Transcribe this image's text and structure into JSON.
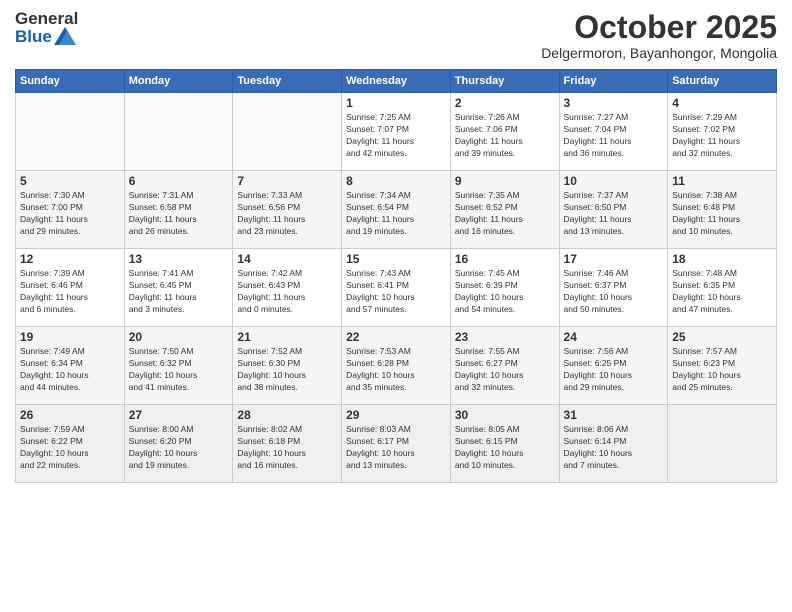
{
  "header": {
    "logo_general": "General",
    "logo_blue": "Blue",
    "month_title": "October 2025",
    "location": "Delgermoron, Bayanhongor, Mongolia"
  },
  "weekdays": [
    "Sunday",
    "Monday",
    "Tuesday",
    "Wednesday",
    "Thursday",
    "Friday",
    "Saturday"
  ],
  "weeks": [
    [
      {
        "day": "",
        "info": ""
      },
      {
        "day": "",
        "info": ""
      },
      {
        "day": "",
        "info": ""
      },
      {
        "day": "1",
        "info": "Sunrise: 7:25 AM\nSunset: 7:07 PM\nDaylight: 11 hours\nand 42 minutes."
      },
      {
        "day": "2",
        "info": "Sunrise: 7:26 AM\nSunset: 7:06 PM\nDaylight: 11 hours\nand 39 minutes."
      },
      {
        "day": "3",
        "info": "Sunrise: 7:27 AM\nSunset: 7:04 PM\nDaylight: 11 hours\nand 36 minutes."
      },
      {
        "day": "4",
        "info": "Sunrise: 7:29 AM\nSunset: 7:02 PM\nDaylight: 11 hours\nand 32 minutes."
      }
    ],
    [
      {
        "day": "5",
        "info": "Sunrise: 7:30 AM\nSunset: 7:00 PM\nDaylight: 11 hours\nand 29 minutes."
      },
      {
        "day": "6",
        "info": "Sunrise: 7:31 AM\nSunset: 6:58 PM\nDaylight: 11 hours\nand 26 minutes."
      },
      {
        "day": "7",
        "info": "Sunrise: 7:33 AM\nSunset: 6:56 PM\nDaylight: 11 hours\nand 23 minutes."
      },
      {
        "day": "8",
        "info": "Sunrise: 7:34 AM\nSunset: 6:54 PM\nDaylight: 11 hours\nand 19 minutes."
      },
      {
        "day": "9",
        "info": "Sunrise: 7:35 AM\nSunset: 6:52 PM\nDaylight: 11 hours\nand 16 minutes."
      },
      {
        "day": "10",
        "info": "Sunrise: 7:37 AM\nSunset: 6:50 PM\nDaylight: 11 hours\nand 13 minutes."
      },
      {
        "day": "11",
        "info": "Sunrise: 7:38 AM\nSunset: 6:48 PM\nDaylight: 11 hours\nand 10 minutes."
      }
    ],
    [
      {
        "day": "12",
        "info": "Sunrise: 7:39 AM\nSunset: 6:46 PM\nDaylight: 11 hours\nand 6 minutes."
      },
      {
        "day": "13",
        "info": "Sunrise: 7:41 AM\nSunset: 6:45 PM\nDaylight: 11 hours\nand 3 minutes."
      },
      {
        "day": "14",
        "info": "Sunrise: 7:42 AM\nSunset: 6:43 PM\nDaylight: 11 hours\nand 0 minutes."
      },
      {
        "day": "15",
        "info": "Sunrise: 7:43 AM\nSunset: 6:41 PM\nDaylight: 10 hours\nand 57 minutes."
      },
      {
        "day": "16",
        "info": "Sunrise: 7:45 AM\nSunset: 6:39 PM\nDaylight: 10 hours\nand 54 minutes."
      },
      {
        "day": "17",
        "info": "Sunrise: 7:46 AM\nSunset: 6:37 PM\nDaylight: 10 hours\nand 50 minutes."
      },
      {
        "day": "18",
        "info": "Sunrise: 7:48 AM\nSunset: 6:35 PM\nDaylight: 10 hours\nand 47 minutes."
      }
    ],
    [
      {
        "day": "19",
        "info": "Sunrise: 7:49 AM\nSunset: 6:34 PM\nDaylight: 10 hours\nand 44 minutes."
      },
      {
        "day": "20",
        "info": "Sunrise: 7:50 AM\nSunset: 6:32 PM\nDaylight: 10 hours\nand 41 minutes."
      },
      {
        "day": "21",
        "info": "Sunrise: 7:52 AM\nSunset: 6:30 PM\nDaylight: 10 hours\nand 38 minutes."
      },
      {
        "day": "22",
        "info": "Sunrise: 7:53 AM\nSunset: 6:28 PM\nDaylight: 10 hours\nand 35 minutes."
      },
      {
        "day": "23",
        "info": "Sunrise: 7:55 AM\nSunset: 6:27 PM\nDaylight: 10 hours\nand 32 minutes."
      },
      {
        "day": "24",
        "info": "Sunrise: 7:56 AM\nSunset: 6:25 PM\nDaylight: 10 hours\nand 29 minutes."
      },
      {
        "day": "25",
        "info": "Sunrise: 7:57 AM\nSunset: 6:23 PM\nDaylight: 10 hours\nand 25 minutes."
      }
    ],
    [
      {
        "day": "26",
        "info": "Sunrise: 7:59 AM\nSunset: 6:22 PM\nDaylight: 10 hours\nand 22 minutes."
      },
      {
        "day": "27",
        "info": "Sunrise: 8:00 AM\nSunset: 6:20 PM\nDaylight: 10 hours\nand 19 minutes."
      },
      {
        "day": "28",
        "info": "Sunrise: 8:02 AM\nSunset: 6:18 PM\nDaylight: 10 hours\nand 16 minutes."
      },
      {
        "day": "29",
        "info": "Sunrise: 8:03 AM\nSunset: 6:17 PM\nDaylight: 10 hours\nand 13 minutes."
      },
      {
        "day": "30",
        "info": "Sunrise: 8:05 AM\nSunset: 6:15 PM\nDaylight: 10 hours\nand 10 minutes."
      },
      {
        "day": "31",
        "info": "Sunrise: 8:06 AM\nSunset: 6:14 PM\nDaylight: 10 hours\nand 7 minutes."
      },
      {
        "day": "",
        "info": ""
      }
    ]
  ]
}
